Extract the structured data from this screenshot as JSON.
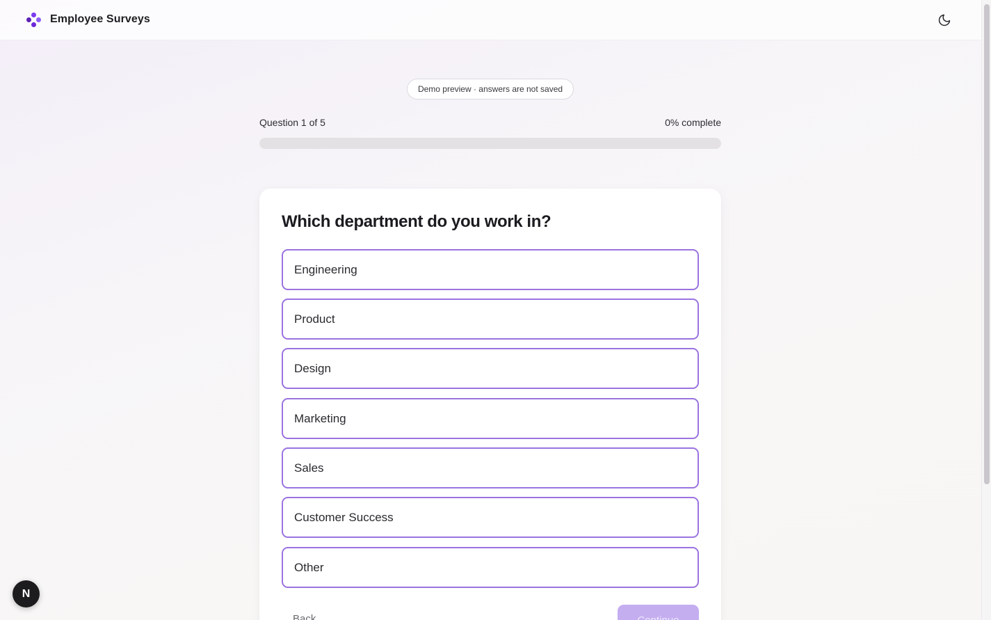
{
  "header": {
    "title": "Employee Surveys",
    "logo_icon": "brand-diamond-dots-icon",
    "theme_toggle_icon": "moon-icon"
  },
  "notice": {
    "text": "Demo preview · answers are not saved"
  },
  "progress": {
    "step_text": "Question 1 of 5",
    "complete_text": "0% complete",
    "fraction": 0
  },
  "survey": {
    "question": "Which department do you work in?",
    "options": [
      {
        "label": "Engineering"
      },
      {
        "label": "Product"
      },
      {
        "label": "Design"
      },
      {
        "label": "Marketing"
      },
      {
        "label": "Sales"
      },
      {
        "label": "Customer Success"
      },
      {
        "label": "Other"
      }
    ],
    "back_label": "Back",
    "continue_label": "Continue"
  },
  "dev_badge": {
    "label": "N"
  },
  "colors": {
    "accent": "#8b5cf6",
    "option_border": "#9a73e0",
    "continue_disabled": "#c4aef0",
    "logo_purple": "#6d28d9"
  }
}
